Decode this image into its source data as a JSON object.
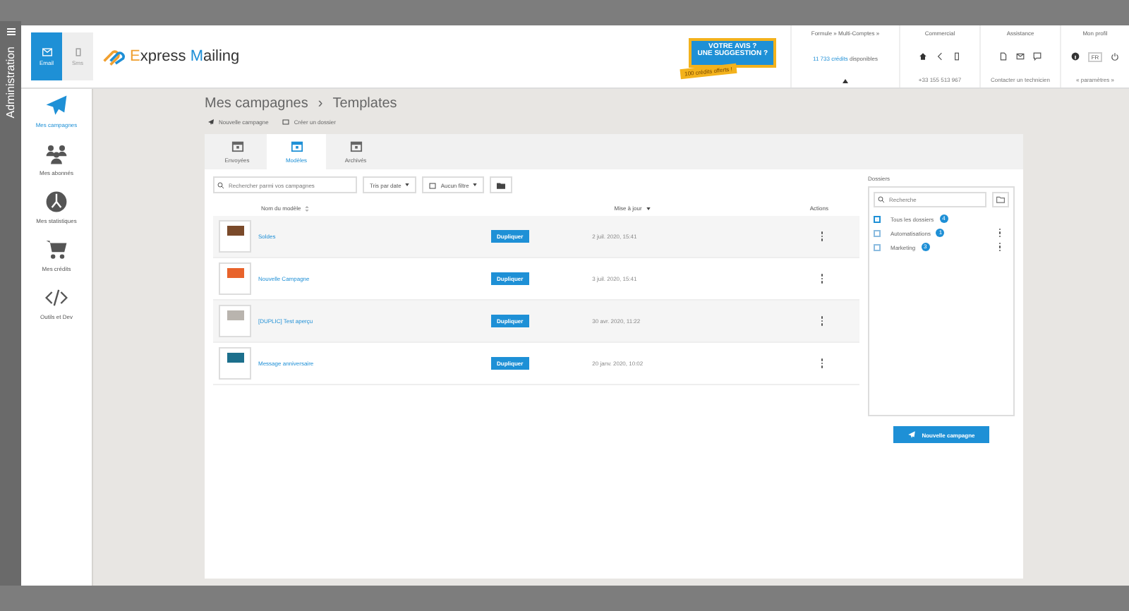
{
  "admin_strip": {
    "label": "Administration"
  },
  "channel_toggle": [
    {
      "label": "Email",
      "selected": true
    },
    {
      "label": "Sms",
      "selected": false
    }
  ],
  "logo": {
    "text_1": "E",
    "text_2": "xpress ",
    "text_3": "M",
    "text_4": "ailing"
  },
  "feedback_banner": {
    "title": "VOTRE AVIS ?",
    "subtitle": "UNE SUGGESTION ?",
    "tag": "100 crédits offerts !"
  },
  "header_sections": [
    {
      "kind": "credits",
      "title": "Formule » Multi-Comptes »",
      "value": "11 733 crédits",
      "suffix": "disponibles"
    },
    {
      "kind": "commercial",
      "title": "Commercial",
      "footer": "+33 155 513 967"
    },
    {
      "kind": "assistance",
      "title": "Assistance",
      "footer": "Contacter un technicien"
    },
    {
      "kind": "profile",
      "title": "Mon profil",
      "badge": "FR",
      "footer": "« paramètres »"
    }
  ],
  "sidebar": {
    "items": [
      {
        "label": "Mes campagnes",
        "selected": true
      },
      {
        "label": "Mes abonnés",
        "selected": false
      },
      {
        "label": "Mes statistiques",
        "selected": false
      },
      {
        "label": "Mes crédits",
        "selected": false
      },
      {
        "label": "Outils et Dev",
        "selected": false
      }
    ]
  },
  "breadcrumb": [
    "Mes campagnes",
    "Templates"
  ],
  "breadcrumb_separator": "›",
  "toolbar": [
    "Nouvelle campagne",
    "Créer un dossier"
  ],
  "tabs": [
    {
      "label": "Envoyées",
      "selected": false
    },
    {
      "label": "Modèles",
      "selected": true
    },
    {
      "label": "Archivés",
      "selected": false
    }
  ],
  "filters": {
    "search_placeholder": "Rechercher parmi vos campagnes",
    "sort": "Tris par date",
    "filter": "Aucun filtre"
  },
  "table": {
    "columns": [
      "Nom du modèle",
      "Mise à jour",
      "Actions"
    ],
    "rows": [
      {
        "name": "Soldes",
        "action": "Dupliquer",
        "updated": "2 juil. 2020, 15:41"
      },
      {
        "name": "Nouvelle Campagne",
        "action": "Dupliquer",
        "updated": "3 juil. 2020, 15:41"
      },
      {
        "name": "[DUPLIC] Test aperçu",
        "action": "Dupliquer",
        "updated": "30 avr. 2020, 11:22"
      },
      {
        "name": "Message anniversaire",
        "action": "Dupliquer",
        "updated": "20 janv. 2020, 10:02"
      }
    ]
  },
  "folders": {
    "title": "Dossiers",
    "search_placeholder": "Recherche",
    "items": [
      {
        "label": "Tous les dossiers",
        "count": "4",
        "checked": true,
        "menu": false
      },
      {
        "label": "Automatisations",
        "count": "1",
        "checked": false,
        "menu": true
      },
      {
        "label": "Marketing",
        "count": "3",
        "checked": false,
        "menu": true
      }
    ]
  },
  "new_campaign_button": "Nouvelle campagne"
}
